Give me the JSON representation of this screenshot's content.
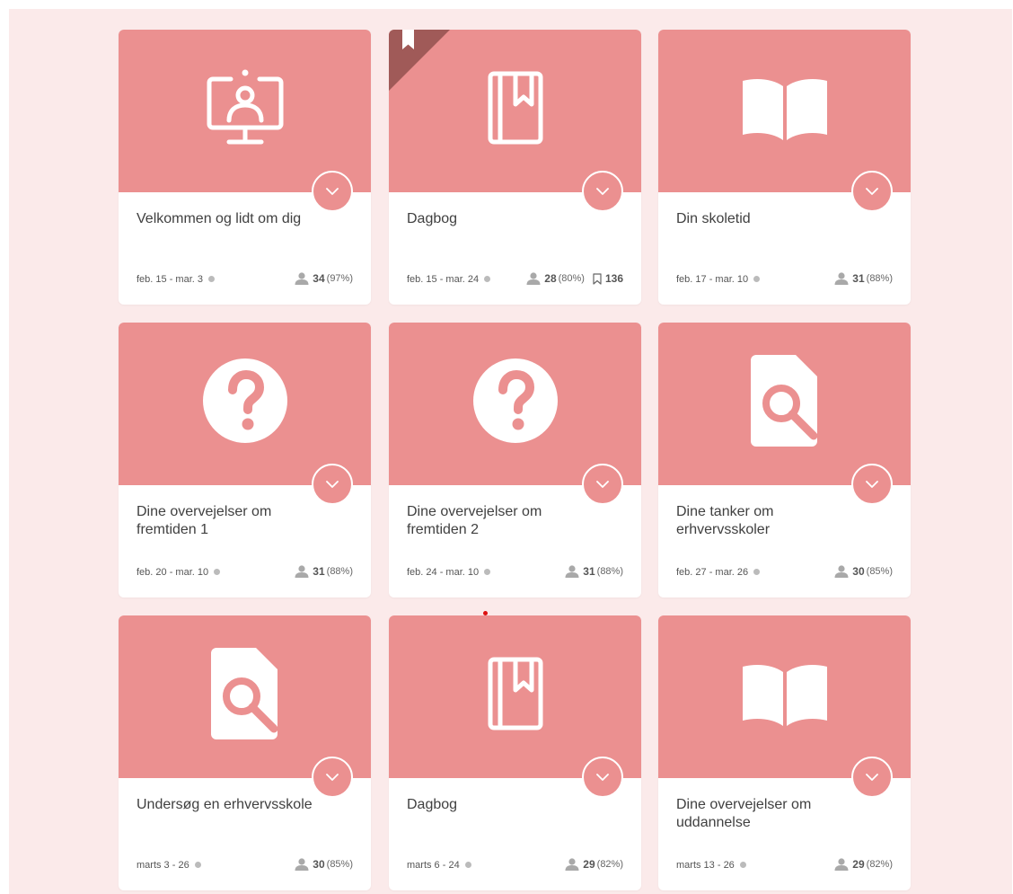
{
  "colors": {
    "page_background": "#fbeaea",
    "card_header": "#eb9090",
    "ribbon": "#a05a58",
    "card_body": "#ffffff"
  },
  "cards": [
    {
      "title": "Velkommen og lidt om dig",
      "icon": "screen-person-icon",
      "dates": "feb. 15 - mar. 3",
      "participants": "34",
      "percent": "(97%)"
    },
    {
      "title": "Dagbog",
      "icon": "diary-icon",
      "dates": "feb. 15 - mar. 24",
      "participants": "28",
      "percent": "(80%)",
      "bookmarks": "136",
      "bookmarked": true
    },
    {
      "title": "Din skoletid",
      "icon": "open-book-icon",
      "dates": "feb. 17 - mar. 10",
      "participants": "31",
      "percent": "(88%)"
    },
    {
      "title": "Dine overvejelser om fremtiden 1",
      "icon": "question-icon",
      "dates": "feb. 20 - mar. 10",
      "participants": "31",
      "percent": "(88%)"
    },
    {
      "title": "Dine overvejelser om fremtiden 2",
      "icon": "question-icon",
      "dates": "feb. 24 - mar. 10",
      "participants": "31",
      "percent": "(88%)"
    },
    {
      "title": "Dine tanker om erhvervsskoler",
      "icon": "document-search-icon",
      "dates": "feb. 27 - mar. 26",
      "participants": "30",
      "percent": "(85%)"
    },
    {
      "title": "Undersøg en erhvervsskole",
      "icon": "document-search-icon",
      "dates": "marts 3 - 26",
      "participants": "30",
      "percent": "(85%)"
    },
    {
      "title": "Dagbog",
      "icon": "diary-icon",
      "dates": "marts 6 - 24",
      "participants": "29",
      "percent": "(82%)"
    },
    {
      "title": "Dine overvejelser om uddannelse",
      "icon": "open-book-icon",
      "dates": "marts 13 - 26",
      "participants": "29",
      "percent": "(82%)"
    }
  ]
}
